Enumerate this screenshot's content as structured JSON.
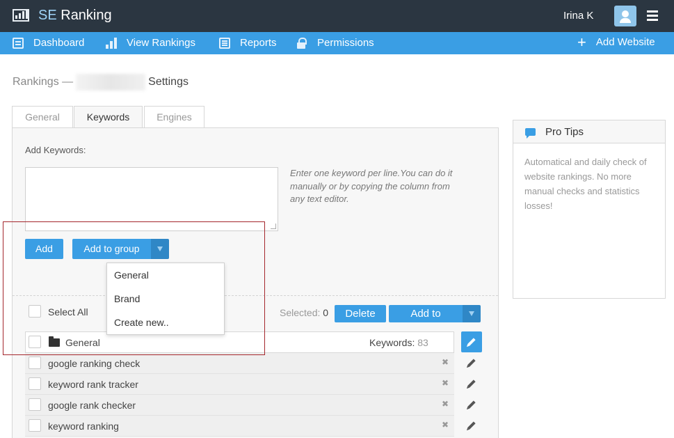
{
  "header": {
    "logo_se": "SE",
    "logo_ranking": " Ranking",
    "user_name": "Irina K"
  },
  "nav": {
    "items": [
      {
        "label": "Dashboard",
        "icon": "dashboard-icon"
      },
      {
        "label": "View Rankings",
        "icon": "bar-chart-icon"
      },
      {
        "label": "Reports",
        "icon": "reports-icon"
      },
      {
        "label": "Permissions",
        "icon": "lock-icon"
      }
    ],
    "add_website": "Add Website"
  },
  "breadcrumb": {
    "rankings": "Rankings —",
    "settings": "Settings"
  },
  "tabs": [
    {
      "label": "General",
      "active": false
    },
    {
      "label": "Keywords",
      "active": true
    },
    {
      "label": "Engines",
      "active": false
    }
  ],
  "keywords_form": {
    "label": "Add Keywords:",
    "textarea_value": "",
    "hint": "Enter one keyword per line.You can do it manually or by copying the column from any text editor.",
    "add_button": "Add",
    "add_to_group_button": "Add to group"
  },
  "group_dropdown": {
    "options": [
      "General",
      "Brand",
      "Create new.."
    ]
  },
  "list_toolbar": {
    "select_all": "Select All",
    "selected_label": "Selected:",
    "selected_count": "0",
    "delete_button": "Delete",
    "add_to_button": "Add to"
  },
  "group": {
    "name": "General",
    "keywords_label": "Keywords:",
    "keywords_count": "83"
  },
  "keywords": [
    "google ranking check",
    "keyword rank tracker",
    "google rank checker",
    "keyword ranking"
  ],
  "pro_tips": {
    "title": "Pro Tips",
    "text": "Automatical and daily check of website rankings. No more manual checks and statistics losses!"
  },
  "colors": {
    "topbar": "#2b3641",
    "navbar": "#3a9ee4",
    "accent": "#3a9ee4",
    "highlight_box": "#a4262c"
  }
}
